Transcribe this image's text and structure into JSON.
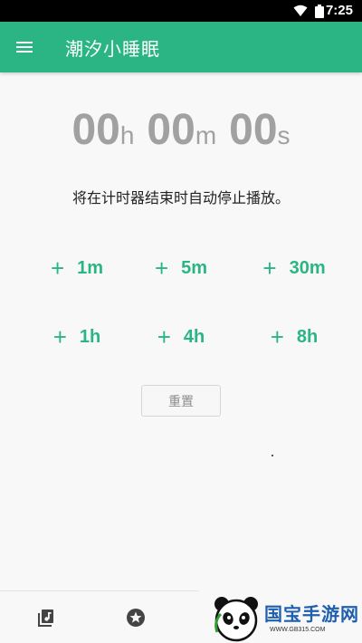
{
  "status_bar": {
    "time": "7:25"
  },
  "app_bar": {
    "title": "潮汐小睡眠"
  },
  "timer": {
    "hours": "00",
    "hours_unit": "h",
    "minutes": "00",
    "minutes_unit": "m",
    "seconds": "00",
    "seconds_unit": "s"
  },
  "description": "将在计时器结束时自动停止播放。",
  "add_buttons": [
    {
      "plus": "+",
      "label": "1m"
    },
    {
      "plus": "+",
      "label": "5m"
    },
    {
      "plus": "+",
      "label": "30m"
    },
    {
      "plus": "+",
      "label": "1h"
    },
    {
      "plus": "+",
      "label": "4h"
    },
    {
      "plus": "+",
      "label": "8h"
    }
  ],
  "reset_label": "重置",
  "bottom_nav": {
    "items": [
      {
        "icon": "music-library-icon"
      },
      {
        "icon": "star-icon"
      }
    ]
  },
  "watermark": {
    "brand": "国宝手游网",
    "domain": "WWW.GB315.COM"
  },
  "colors": {
    "accent": "#2bb584",
    "timer_text": "#a1a1a1",
    "status_bar": "#000000"
  }
}
